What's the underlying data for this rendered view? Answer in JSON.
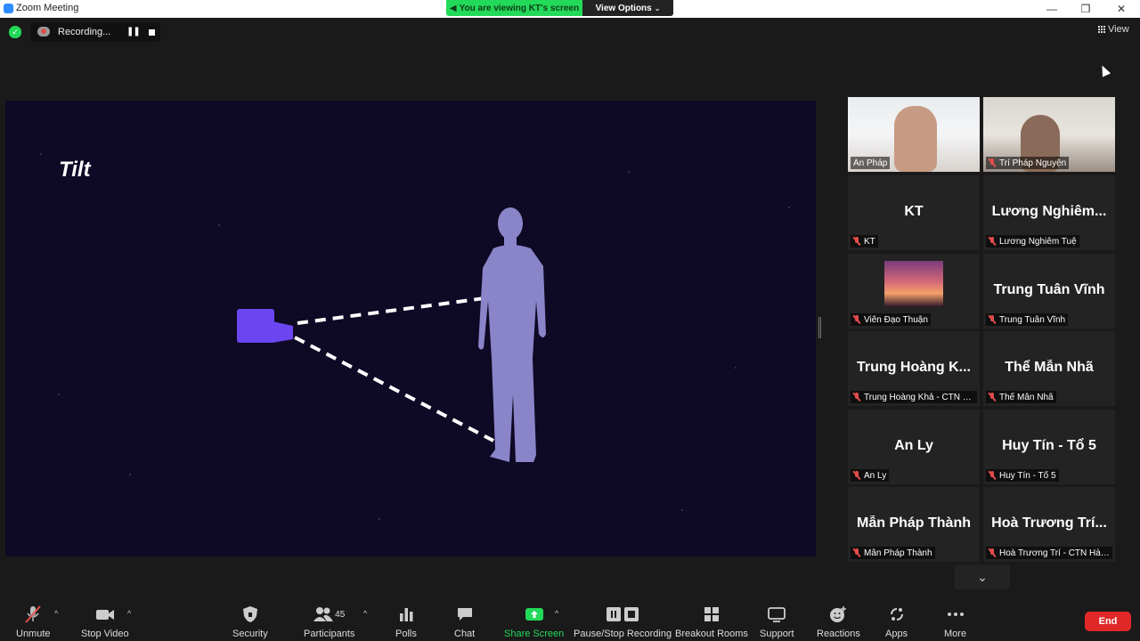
{
  "window": {
    "title": "Zoom Meeting",
    "share_banner": "You are viewing KT's screen",
    "view_options": "View Options",
    "minimize": "—",
    "maximize": "❐",
    "close": "✕"
  },
  "top": {
    "recording_label": "Recording...",
    "view_label": "View"
  },
  "shared_screen": {
    "presenter": "KT",
    "slide_title": "Tilt",
    "colors": {
      "background": "#0e0924",
      "camera": "#6b46f0",
      "person": "#8a85c9"
    }
  },
  "participants": [
    {
      "big_name": "",
      "label": "Ân Pháp",
      "muted": false,
      "video": true,
      "active_speaker": true
    },
    {
      "big_name": "",
      "label": "Trí Pháp Nguyện",
      "muted": true,
      "video": true
    },
    {
      "big_name": "KT",
      "label": "KT",
      "muted": true
    },
    {
      "big_name": "Lương  Nghiêm...",
      "label": "Lương Nghiêm Tuệ",
      "muted": true
    },
    {
      "big_name": "",
      "label": "Viên Đạo Thuận",
      "muted": true,
      "image": true
    },
    {
      "big_name": "Trung Tuân Vĩnh",
      "label": "Trung Tuân Vĩnh",
      "muted": true
    },
    {
      "big_name": "Trung Hoàng K...",
      "label": "Trung Hoàng Khả - CTN H...",
      "muted": true
    },
    {
      "big_name": "Thể Mẫn Nhã",
      "label": "Thể Mẫn Nhã",
      "muted": true
    },
    {
      "big_name": "An Ly",
      "label": "An Ly",
      "muted": true
    },
    {
      "big_name": "Huy Tín - Tổ 5",
      "label": "Huy Tín - Tổ 5",
      "muted": true
    },
    {
      "big_name": "Mẫn Pháp Thành",
      "label": "Mẫn Pháp Thành",
      "muted": true
    },
    {
      "big_name": "Hoà Trương Trí...",
      "label": "Hoà Trương Trí - CTN Hà ...",
      "muted": true
    }
  ],
  "toolbar": {
    "unmute": "Unmute",
    "stop_video": "Stop Video",
    "security": "Security",
    "participants": "Participants",
    "participants_count": "45",
    "polls": "Polls",
    "chat": "Chat",
    "share_screen": "Share Screen",
    "pause_stop_recording": "Pause/Stop Recording",
    "breakout_rooms": "Breakout Rooms",
    "support": "Support",
    "reactions": "Reactions",
    "apps": "Apps",
    "more": "More",
    "end": "End",
    "accent_green": "#23d959",
    "end_red": "#e02828"
  }
}
